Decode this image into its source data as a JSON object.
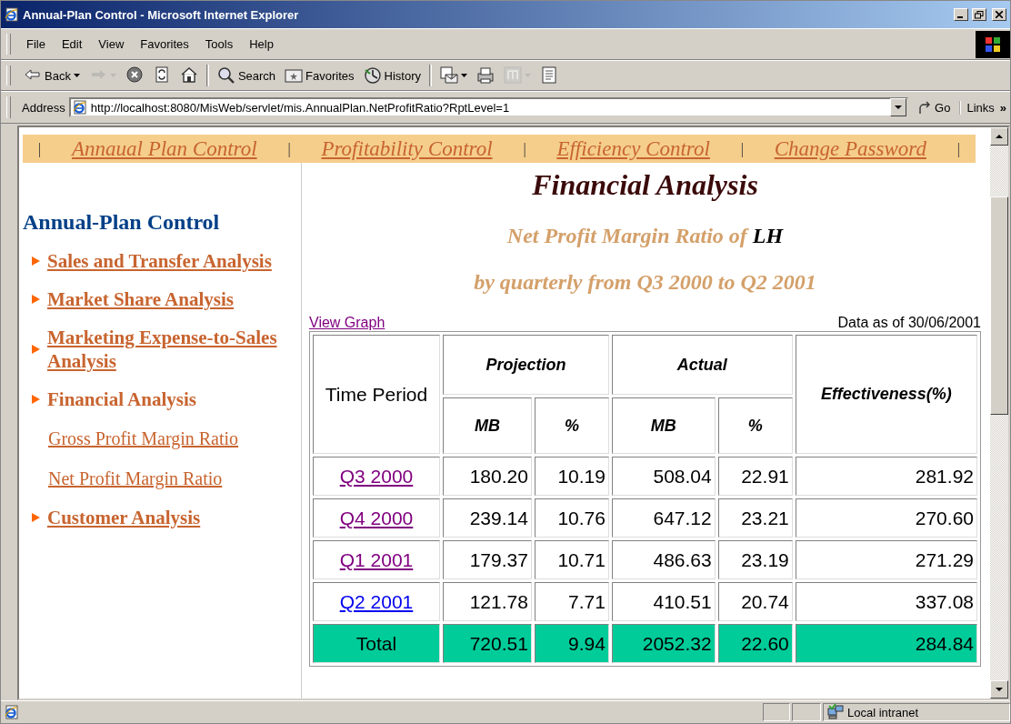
{
  "window": {
    "title": "Annual-Plan Control - Microsoft Internet Explorer"
  },
  "menu": [
    "File",
    "Edit",
    "View",
    "Favorites",
    "Tools",
    "Help"
  ],
  "toolbar": [
    {
      "kind": "back",
      "label": "Back",
      "disabled": false
    },
    {
      "kind": "forward",
      "disabled": true
    },
    {
      "kind": "stop",
      "disabled": false
    },
    {
      "kind": "refresh",
      "disabled": false
    },
    {
      "kind": "home",
      "disabled": false
    },
    {
      "kind": "search",
      "label": "Search",
      "disabled": false
    },
    {
      "kind": "favorites",
      "label": "Favorites",
      "disabled": false
    },
    {
      "kind": "history",
      "label": "History",
      "disabled": false
    },
    {
      "kind": "mail",
      "disabled": false
    },
    {
      "kind": "print",
      "disabled": false
    },
    {
      "kind": "edit",
      "disabled": true
    },
    {
      "kind": "discuss",
      "disabled": false
    }
  ],
  "address": {
    "label": "Address",
    "value": "http://localhost:8080/MisWeb/servlet/mis.AnnualPlan.NetProfitRatio?RptLevel=1",
    "go": "Go",
    "links": "Links",
    "more": "»"
  },
  "nav": {
    "separator": "|",
    "items": [
      "Annaual Plan Control",
      "Profitability Control",
      "Efficiency Control",
      "Change Password"
    ]
  },
  "sidebar": {
    "title": "Annual-Plan Control",
    "items": [
      {
        "label": "Sales and Transfer Analysis",
        "selected": false
      },
      {
        "label": "Market Share Analysis",
        "selected": false
      },
      {
        "label": "Marketing Expense-to-Sales Analysis",
        "selected": false
      },
      {
        "label": "Financial Analysis",
        "selected": true,
        "children": [
          {
            "label": "Gross Profit Margin Ratio"
          },
          {
            "label": "Net Profit Margin Ratio"
          }
        ]
      },
      {
        "label": "Customer Analysis",
        "selected": false
      }
    ]
  },
  "report": {
    "title": "Financial Analysis",
    "subtitle": "Net Profit Margin Ratio of",
    "company": "LH",
    "period": "by quarterly from Q3 2000 to Q2 2001",
    "view_graph": {
      "label": "View Graph",
      "visited": true
    },
    "as_of": "Data as of 30/06/2001"
  },
  "table": {
    "period_header": "Time Period",
    "groups": [
      {
        "label": "Projection",
        "sub": [
          "MB",
          "%"
        ]
      },
      {
        "label": "Actual",
        "sub": [
          "MB",
          "%"
        ]
      }
    ],
    "effectiveness_header": "Effectiveness(%)",
    "rows": [
      {
        "period": "Q3 2000",
        "visited": true,
        "cells": [
          "180.20",
          "10.19",
          "508.04",
          "22.91",
          "281.92"
        ]
      },
      {
        "period": "Q4 2000",
        "visited": true,
        "cells": [
          "239.14",
          "10.76",
          "647.12",
          "23.21",
          "270.60"
        ]
      },
      {
        "period": "Q1 2001",
        "visited": true,
        "cells": [
          "179.37",
          "10.71",
          "486.63",
          "23.19",
          "271.29"
        ]
      },
      {
        "period": "Q2 2001",
        "visited": false,
        "cells": [
          "121.78",
          "7.71",
          "410.51",
          "20.74",
          "337.08"
        ]
      }
    ],
    "total": {
      "label": "Total",
      "cells": [
        "720.51",
        "9.94",
        "2052.32",
        "22.60",
        "284.84"
      ]
    }
  },
  "status": {
    "zone": "Local intranet"
  }
}
